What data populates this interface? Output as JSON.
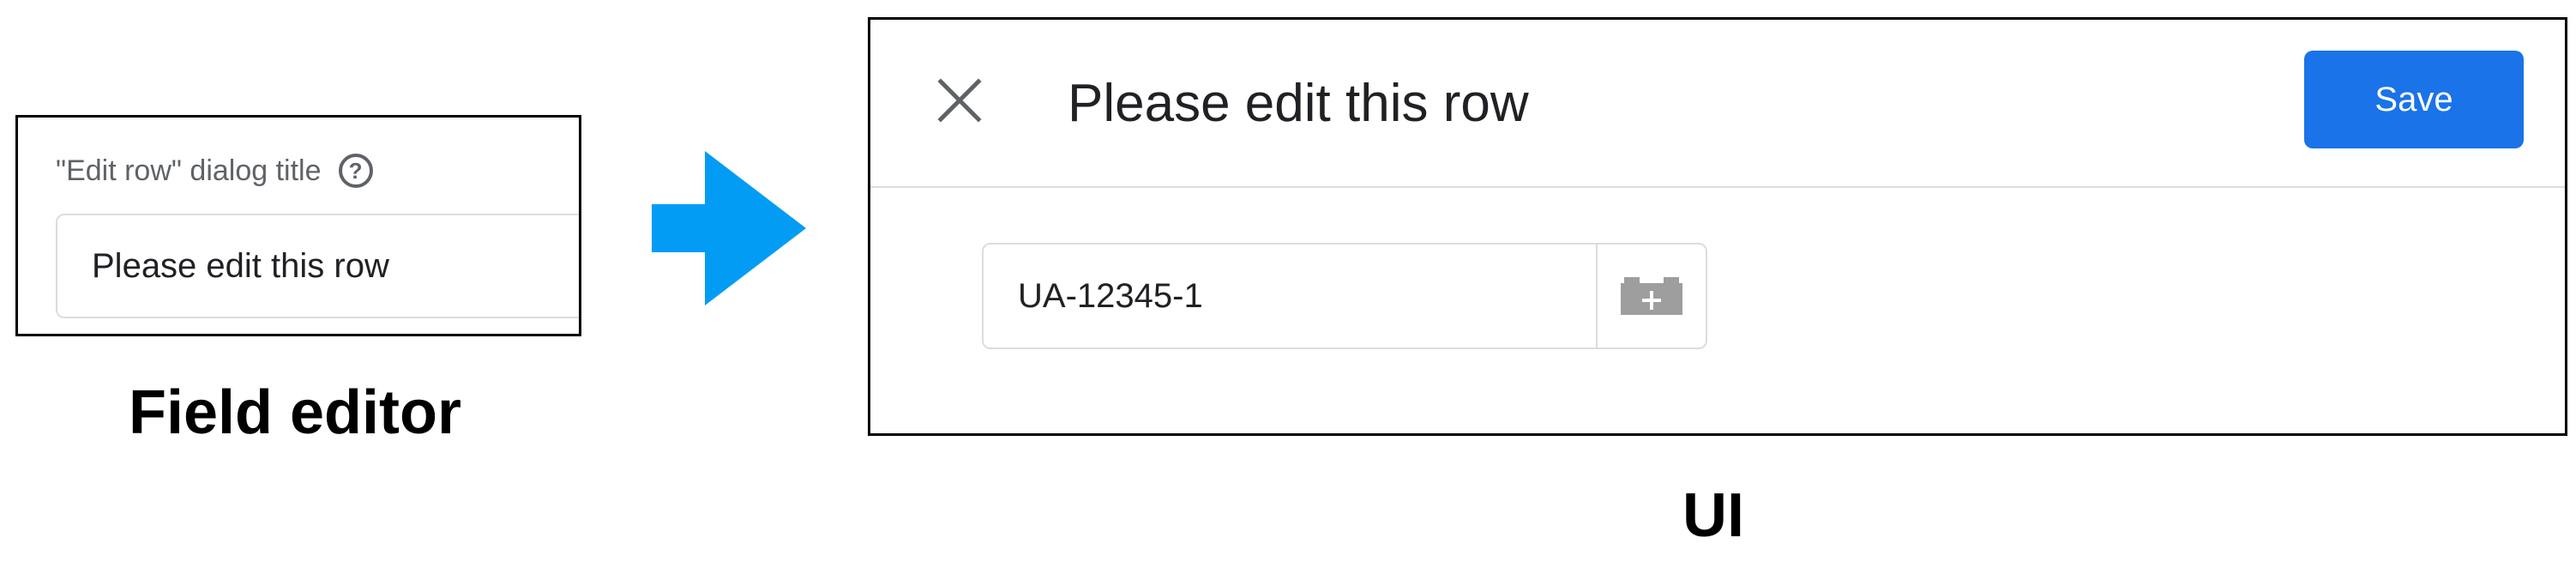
{
  "field_editor": {
    "label": "\"Edit row\" dialog title",
    "help_icon": "?",
    "value": "Please edit this row",
    "caption": "Field editor"
  },
  "arrow": {
    "color": "#039cf5"
  },
  "dialog": {
    "close_icon": "close-icon",
    "title": "Please edit this row",
    "save_label": "Save",
    "input_value": "UA-12345-1",
    "variable_icon": "variable-plus-icon",
    "caption": "UI",
    "accent_color": "#1a73e8"
  }
}
